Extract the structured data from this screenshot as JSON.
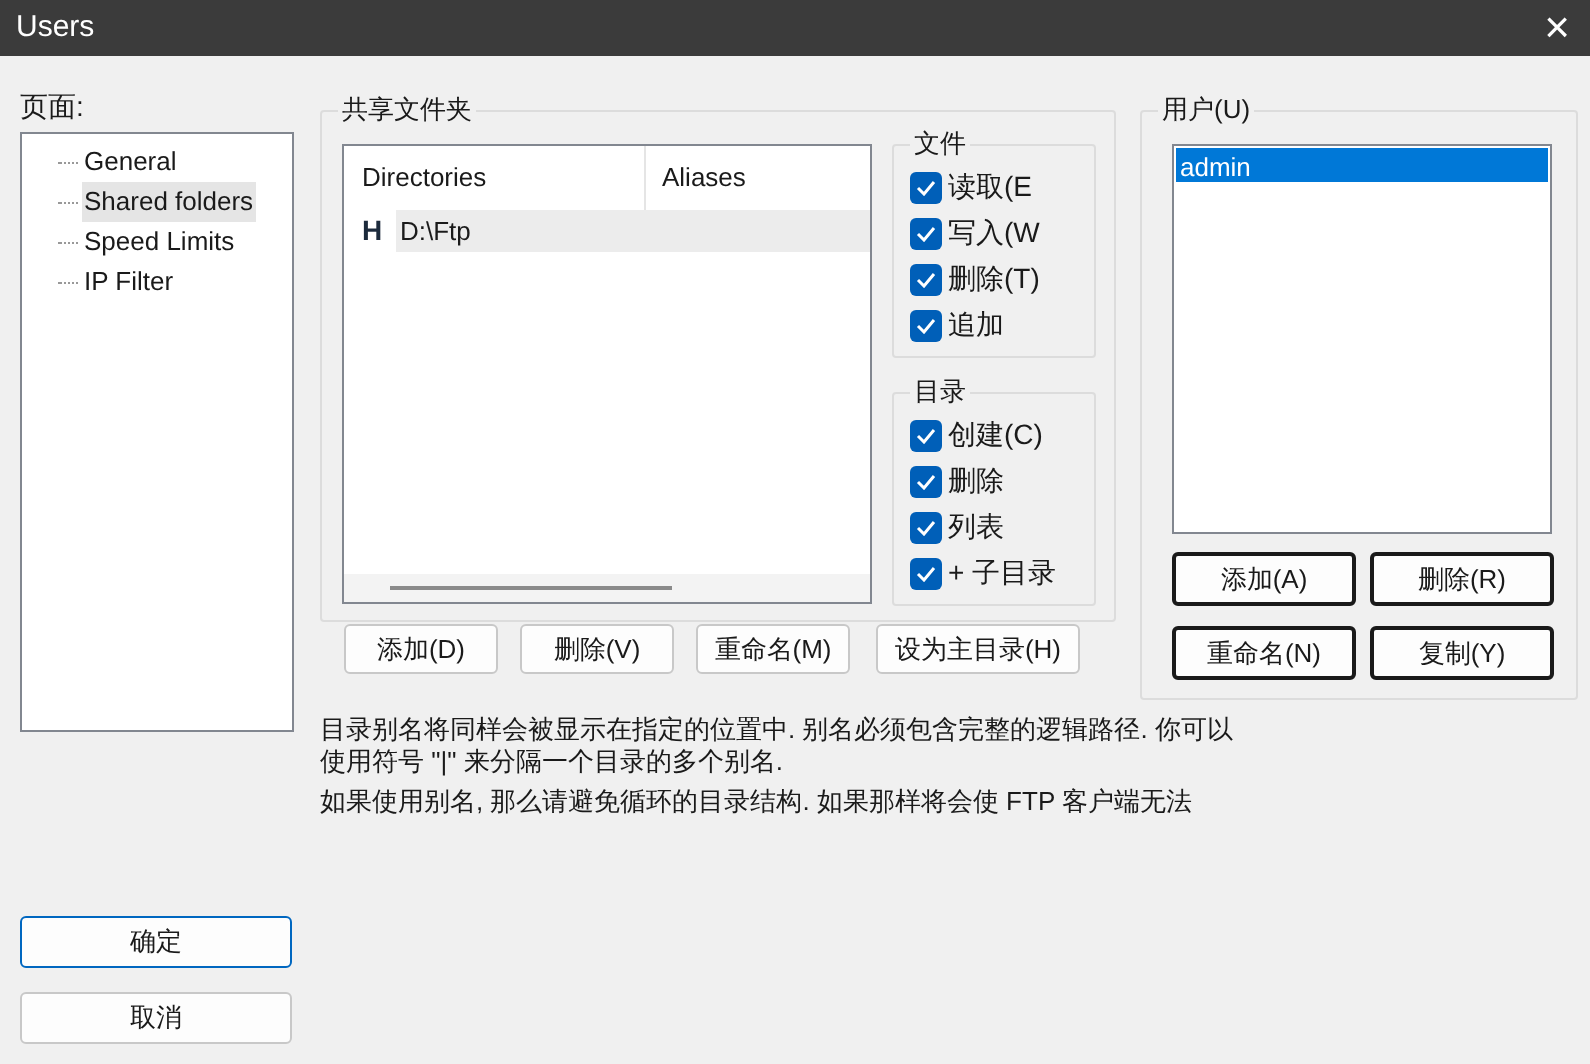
{
  "window": {
    "title": "Users",
    "close": "×"
  },
  "pages": {
    "label": "页面:",
    "items": [
      {
        "label": "General",
        "selected": false
      },
      {
        "label": "Shared folders",
        "selected": true
      },
      {
        "label": "Speed Limits",
        "selected": false
      },
      {
        "label": "IP Filter",
        "selected": false
      }
    ]
  },
  "shared_folders": {
    "title": "共享文件夹",
    "columns": [
      "Directories",
      "Aliases"
    ],
    "rows": [
      {
        "marker": "H",
        "directory": "D:\\Ftp",
        "selected": true
      }
    ],
    "buttons": [
      "添加(D)",
      "删除(V)",
      "重命名(M)",
      "设为主目录(H)"
    ]
  },
  "file_permissions": {
    "title": "文件",
    "items": [
      {
        "label": "读取(E",
        "checked": true
      },
      {
        "label": "写入(W",
        "checked": true
      },
      {
        "label": "删除(T)",
        "checked": true
      },
      {
        "label": "追加",
        "checked": true
      }
    ]
  },
  "dir_permissions": {
    "title": "目录",
    "items": [
      {
        "label": "创建(C)",
        "checked": true
      },
      {
        "label": "删除",
        "checked": true
      },
      {
        "label": "列表",
        "checked": true
      },
      {
        "label": "+ 子目录",
        "checked": true
      }
    ]
  },
  "notes": [
    "目录别名将同样会被显示在指定的位置中. 别名必须包含完整的逻辑路径. 你可以使用符号 \"|\" 来分隔一个目录的多个别名.",
    "如果使用别名, 那么请避免循环的目录结构. 如果那样将会使 FTP 客户端无法"
  ],
  "users": {
    "title": "用户(U)",
    "items": [
      {
        "label": "admin",
        "selected": true
      }
    ],
    "buttons": [
      "添加(A)",
      "删除(R)",
      "重命名(N)",
      "复制(Y)"
    ]
  },
  "dialog_buttons": [
    {
      "label": "确定",
      "default": true
    },
    {
      "label": "取消",
      "default": false
    }
  ]
}
